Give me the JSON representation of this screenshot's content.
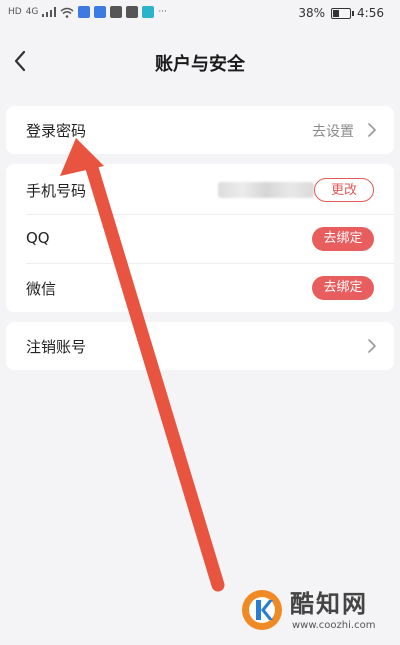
{
  "status_bar": {
    "network_label": "HD",
    "signal_label": "4G",
    "battery_percent": "38%",
    "time": "4:56",
    "more": "···"
  },
  "header": {
    "title": "账户与安全"
  },
  "settings": {
    "login_password": {
      "label": "登录密码",
      "value": "去设置"
    },
    "phone": {
      "label": "手机号码",
      "action": "更改"
    },
    "qq": {
      "label": "QQ",
      "action": "去绑定"
    },
    "wechat": {
      "label": "微信",
      "action": "去绑定"
    },
    "cancel_account": {
      "label": "注销账号"
    }
  },
  "colors": {
    "accent": "#e85d5d",
    "arrow": "#e8543f",
    "background": "#f4f4f6"
  },
  "watermark": {
    "name": "酷知网",
    "url": "www.coozhi.com"
  }
}
